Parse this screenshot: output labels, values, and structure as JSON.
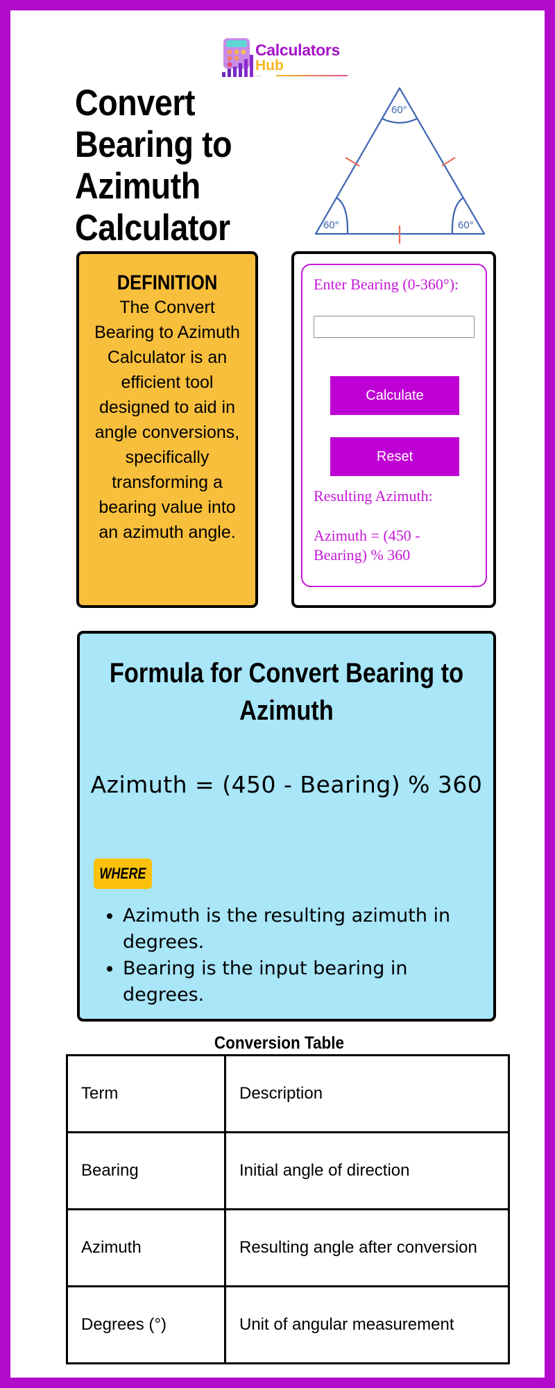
{
  "logo": {
    "line1": "Calculators",
    "line2": "Hub",
    "dots": "•••",
    "icon": "calculator-chart-icon"
  },
  "page_title": "Convert Bearing to Azimuth Calculator",
  "illustration": {
    "icon": "equilateral-triangle-icon",
    "angle_labels": [
      "60°",
      "60°",
      "60°"
    ]
  },
  "definition": {
    "heading": "DEFINITION",
    "text": "The Convert Bearing to Azimuth Calculator is an efficient tool designed to aid in angle conversions, specifically transforming a bearing value into an azimuth angle."
  },
  "calculator": {
    "input_label": "Enter Bearing (0-360°):",
    "input_value": "",
    "calculate_label": "Calculate",
    "reset_label": "Reset",
    "result_label": "Resulting Azimuth:",
    "result_formula": "Azimuth = (450 - Bearing) % 360"
  },
  "formula": {
    "title": "Formula for Convert Bearing to Azimuth",
    "expression": "Azimuth = (450 - Bearing) % 360",
    "where_label": "WHERE",
    "variables": [
      "Azimuth is the resulting azimuth in degrees.",
      "Bearing is the input bearing in degrees."
    ]
  },
  "table": {
    "title": "Conversion Table",
    "rows": [
      [
        "Term",
        "Description"
      ],
      [
        "Bearing",
        "Initial angle of direction"
      ],
      [
        "Azimuth",
        "Resulting angle after conversion"
      ],
      [
        "Degrees (°)",
        "Unit of angular measurement"
      ]
    ]
  },
  "colors": {
    "frame": "#b30bcc",
    "definition_bg": "#f8bf3c",
    "calculator_accent": "#bf00d4",
    "formula_bg": "#a8e6f8",
    "where_badge": "#fcc10c",
    "triangle_stroke": "#3b63b0",
    "triangle_tick": "#ea6a55"
  }
}
